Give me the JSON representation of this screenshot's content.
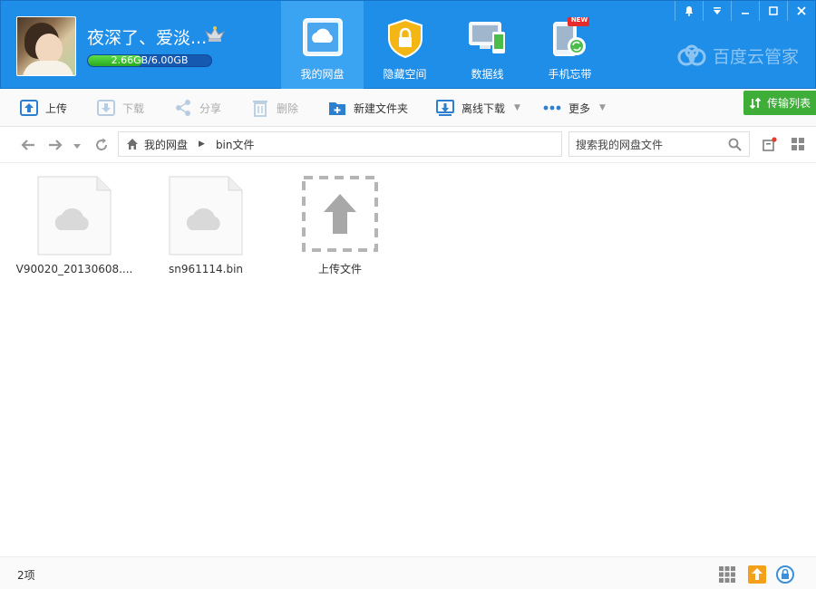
{
  "user": {
    "name": "夜深了、爱淡...",
    "quota_text": "2.66GB/6.00GB",
    "quota_used_fraction": 0.443
  },
  "nav": [
    {
      "label": "我的网盘",
      "icon": "cloud-drive-icon",
      "active": true
    },
    {
      "label": "隐藏空间",
      "icon": "lock-shield-icon",
      "active": false
    },
    {
      "label": "数据线",
      "icon": "devices-icon",
      "active": false
    },
    {
      "label": "手机忘带",
      "icon": "phone-sync-icon",
      "active": false,
      "badge": "NEW"
    }
  ],
  "window": {
    "controls": [
      "bell-icon",
      "dropdown-icon",
      "minimize-icon",
      "maximize-icon",
      "close-icon"
    ]
  },
  "brand": {
    "name": "百度云管家"
  },
  "toolbar": {
    "upload": "上传",
    "download": "下载",
    "share": "分享",
    "delete": "删除",
    "new_folder": "新建文件夹",
    "offline_download": "离线下载",
    "more": "更多",
    "transfer_list": "传输列表"
  },
  "address": {
    "root": "我的网盘",
    "current": "bin文件"
  },
  "search": {
    "placeholder": "搜索我的网盘文件"
  },
  "files": [
    {
      "name": "V90020_20130608....",
      "type": "file"
    },
    {
      "name": "sn961114.bin",
      "type": "file"
    },
    {
      "name": "上传文件",
      "type": "upload"
    }
  ],
  "status": {
    "count": "2项"
  },
  "colors": {
    "header": "#1f8ee8",
    "active_tab": "#3aa3f2",
    "transfer_green": "#3fae39"
  }
}
